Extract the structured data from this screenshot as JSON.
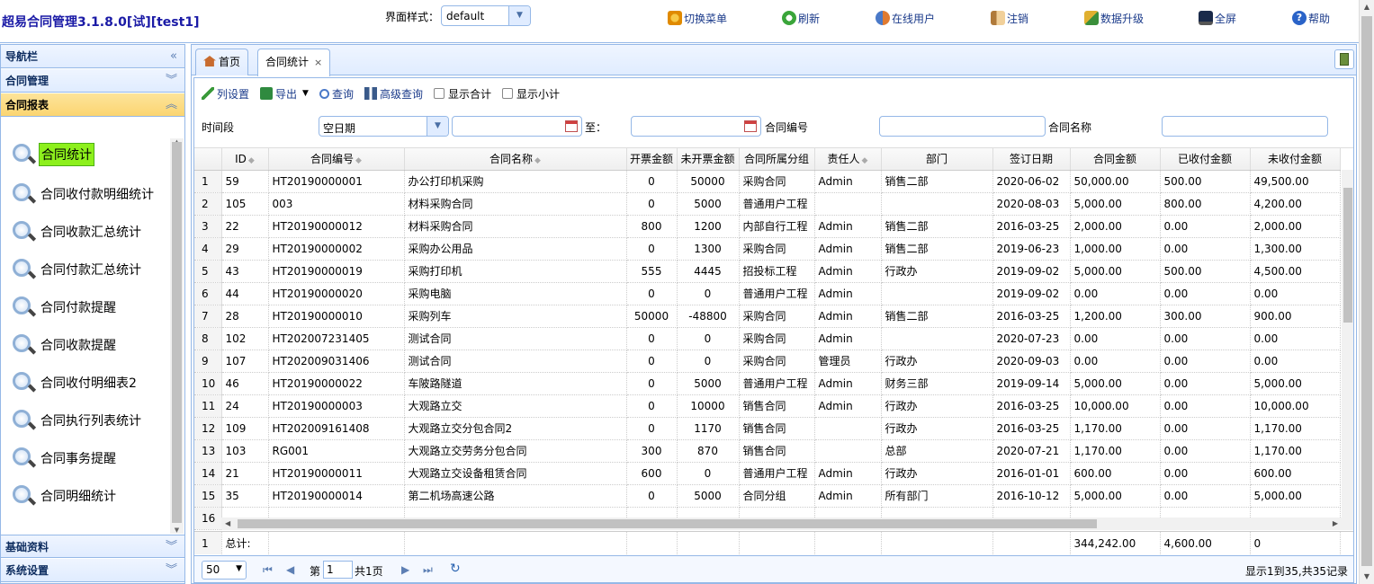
{
  "app": {
    "title": "超易合同管理3.1.8.0[试][test1]"
  },
  "top": {
    "theme_label": "界面样式：",
    "theme_value": "default",
    "buttons": [
      "切换菜单",
      "刷新",
      "在线用户",
      "注销",
      "数据升级",
      "全屏",
      "帮助"
    ]
  },
  "sidebar": {
    "nav_title": "导航栏",
    "sections": [
      "合同管理",
      "合同报表",
      "基础资料",
      "系统设置"
    ],
    "items": [
      "合同统计",
      "合同收付款明细统计",
      "合同收款汇总统计",
      "合同付款汇总统计",
      "合同付款提醒",
      "合同收款提醒",
      "合同收付明细表2",
      "合同执行列表统计",
      "合同事务提醒",
      "合同明细统计"
    ]
  },
  "tabs": [
    "首页",
    "合同统计"
  ],
  "toolbar": {
    "col_settings": "列设置",
    "export": "导出",
    "query": "查询",
    "adv_query": "高级查询",
    "show_total": "显示合计",
    "show_subtotal": "显示小计"
  },
  "filter": {
    "period_label": "时间段",
    "period_value": "空日期",
    "to_label": "至：",
    "contract_no_label": "合同编号",
    "contract_name_label": "合同名称"
  },
  "table": {
    "columns": [
      "ID",
      "合同编号",
      "合同名称",
      "开票金额",
      "未开票金额",
      "合同所属分组",
      "责任人",
      "部门",
      "签订日期",
      "合同金额",
      "已收付金额",
      "未收付金额"
    ],
    "rows": [
      [
        "1",
        "59",
        "HT20190000001",
        "办公打印机采购",
        "0",
        "50000",
        "采购合同",
        "Admin",
        "销售二部",
        "2020-06-02",
        "50,000.00",
        "500.00",
        "49,500.00"
      ],
      [
        "2",
        "105",
        "003",
        "材料采购合同",
        "0",
        "5000",
        "普通用户工程",
        "",
        "",
        "2020-08-03",
        "5,000.00",
        "800.00",
        "4,200.00"
      ],
      [
        "3",
        "22",
        "HT20190000012",
        "材料采购合同",
        "800",
        "1200",
        "内部自行工程",
        "Admin",
        "销售二部",
        "2016-03-25",
        "2,000.00",
        "0.00",
        "2,000.00"
      ],
      [
        "4",
        "29",
        "HT20190000002",
        "采购办公用品",
        "0",
        "1300",
        "采购合同",
        "Admin",
        "销售二部",
        "2019-06-23",
        "1,000.00",
        "0.00",
        "1,300.00"
      ],
      [
        "5",
        "43",
        "HT20190000019",
        "采购打印机",
        "555",
        "4445",
        "招投标工程",
        "Admin",
        "行政办",
        "2019-09-02",
        "5,000.00",
        "500.00",
        "4,500.00"
      ],
      [
        "6",
        "44",
        "HT20190000020",
        "采购电脑",
        "0",
        "0",
        "普通用户工程",
        "Admin",
        "",
        "2019-09-02",
        "0.00",
        "0.00",
        "0.00"
      ],
      [
        "7",
        "28",
        "HT20190000010",
        "采购列车",
        "50000",
        "-48800",
        "采购合同",
        "Admin",
        "销售二部",
        "2016-03-25",
        "1,200.00",
        "300.00",
        "900.00"
      ],
      [
        "8",
        "102",
        "HT202007231405",
        "测试合同",
        "0",
        "0",
        "采购合同",
        "Admin",
        "",
        "2020-07-23",
        "0.00",
        "0.00",
        "0.00"
      ],
      [
        "9",
        "107",
        "HT202009031406",
        "测试合同",
        "0",
        "0",
        "采购合同",
        "管理员",
        "行政办",
        "2020-09-03",
        "0.00",
        "0.00",
        "0.00"
      ],
      [
        "10",
        "46",
        "HT20190000022",
        "车陂路隧道",
        "0",
        "5000",
        "普通用户工程",
        "Admin",
        "财务三部",
        "2019-09-14",
        "5,000.00",
        "0.00",
        "5,000.00"
      ],
      [
        "11",
        "24",
        "HT20190000003",
        "大观路立交",
        "0",
        "10000",
        "销售合同",
        "Admin",
        "行政办",
        "2016-03-25",
        "10,000.00",
        "0.00",
        "10,000.00"
      ],
      [
        "12",
        "109",
        "HT202009161408",
        "大观路立交分包合同2",
        "0",
        "1170",
        "销售合同",
        "",
        "行政办",
        "2016-03-25",
        "1,170.00",
        "0.00",
        "1,170.00"
      ],
      [
        "13",
        "103",
        "RG001",
        "大观路立交劳务分包合同",
        "300",
        "870",
        "销售合同",
        "",
        "总部",
        "2020-07-21",
        "1,170.00",
        "0.00",
        "1,170.00"
      ],
      [
        "14",
        "21",
        "HT20190000011",
        "大观路立交设备租赁合同",
        "600",
        "0",
        "普通用户工程",
        "Admin",
        "行政办",
        "2016-01-01",
        "600.00",
        "0.00",
        "600.00"
      ],
      [
        "15",
        "35",
        "HT20190000014",
        "第二机场高速公路",
        "0",
        "5000",
        "合同分组",
        "Admin",
        "所有部门",
        "2016-10-12",
        "5,000.00",
        "0.00",
        "5,000.00"
      ],
      [
        "16",
        "",
        "",
        "",
        "",
        "",
        "",
        "",
        "",
        "",
        "",
        "",
        ""
      ]
    ],
    "footer": {
      "rn": "1",
      "label": "总计:",
      "contract_amount": "344,242.00",
      "paid": "4,600.00",
      "unpaid": "0"
    }
  },
  "pager": {
    "page_size": "50",
    "page_label_a": "第",
    "page_value": "1",
    "page_label_b": "共1页",
    "info": "显示1到35,共35记录"
  },
  "colors": {
    "accent": "#95b8e7",
    "header_bg": "#e0ecff",
    "active_section": "#fbd571",
    "selected_item": "#8df01c"
  }
}
